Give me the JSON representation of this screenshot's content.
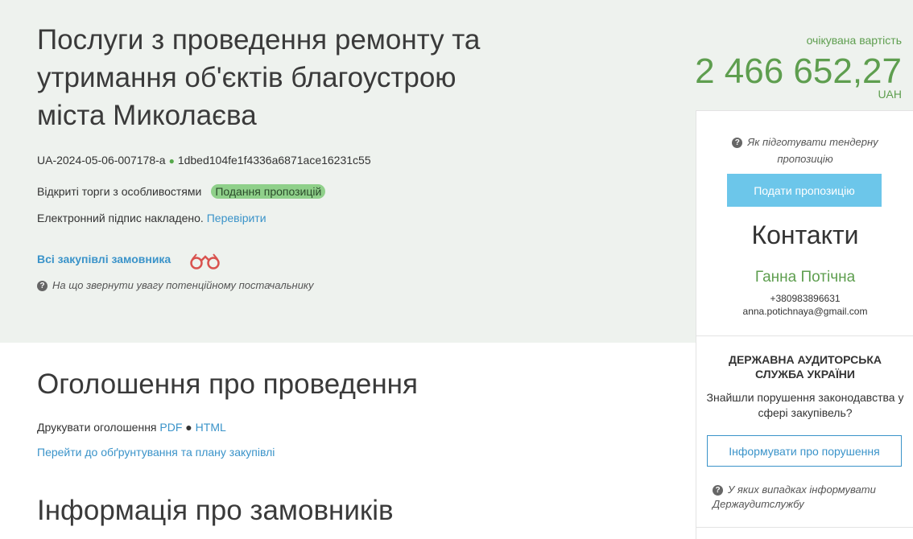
{
  "tender": {
    "title": "Послуги з проведення ремонту та утримання об'єктів благоустрою міста Миколаєва",
    "id": "UA-2024-05-06-007178-a",
    "hash": "1dbed104fe1f4336a6871ace16231c55",
    "procedure_type": "Відкриті торги з особливостями",
    "status_badge": "Подання пропозицій",
    "signature_text": "Електронний підпис накладено.",
    "signature_link": "Перевірити",
    "buyer_link": "Всі закупівлі замовника",
    "supplier_help": "На що звернути увагу потенційному постачальнику"
  },
  "price": {
    "label": "очікувана вартість",
    "value": "2 466 652,27",
    "currency": "UAH"
  },
  "sidebar": {
    "help_tender": "Як підготувати тендерну пропозицію",
    "submit_button": "Подати пропозицію",
    "contacts_title": "Контакти",
    "contact_name": "Ганна Потічна",
    "contact_phone": "+380983896631",
    "contact_email": "anna.potichnaya@gmail.com",
    "audit_title": "ДЕРЖАВНА АУДИТОРСЬКА СЛУЖБА УКРАЇНИ",
    "audit_question": "Знайшли порушення законодавства у сфері закупівель?",
    "report_button": "Інформувати про порушення",
    "audit_help": "У яких випадках інформувати Держаудитслужбу"
  },
  "announcement": {
    "title": "Оголошення про проведення",
    "print_label": "Друкувати оголошення",
    "pdf": "PDF",
    "html": "HTML",
    "plan_link": "Перейти до обґрунтування та плану закупівлі"
  },
  "customers": {
    "title": "Інформація про замовників"
  },
  "colors": {
    "accent_green": "#5e9e4f",
    "link_blue": "#3a93c9",
    "badge_green": "#8fd08a",
    "button_blue": "#6cc6ea",
    "hero_bg": "#eef2ee"
  },
  "icons": [
    "help-circle-icon",
    "binoculars-icon"
  ]
}
